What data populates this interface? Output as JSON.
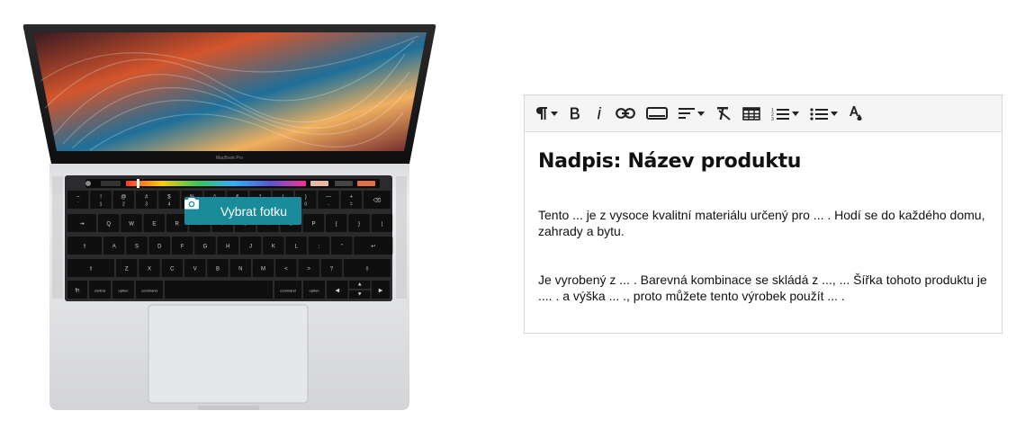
{
  "photo_button": {
    "label": "Vybrat fotku",
    "icon": "camera-icon"
  },
  "laptop": {
    "brand_label": "MacBook Pro",
    "keys": {
      "row1": [
        "~",
        "!",
        "@",
        "#",
        "$",
        "%",
        "^",
        "&",
        "*",
        "(",
        ")",
        "—",
        "+"
      ],
      "row1_sub": [
        "`",
        "1",
        "2",
        "3",
        "4",
        "5",
        "6",
        "7",
        "8",
        "9",
        "0",
        "-",
        "="
      ],
      "row2": [
        "Q",
        "W",
        "E",
        "R",
        "T",
        "Y",
        "U",
        "I",
        "O",
        "P",
        "{",
        "}",
        "|"
      ],
      "row3": [
        "A",
        "S",
        "D",
        "F",
        "G",
        "H",
        "J",
        "K",
        "L",
        ":",
        "\""
      ],
      "row4": [
        "Z",
        "X",
        "C",
        "V",
        "B",
        "N",
        "M",
        "<",
        ">",
        "?"
      ],
      "tab": "⇥",
      "caps": "⇪",
      "shift": "⇧",
      "delete": "⌫",
      "return": "↩",
      "fn": "fn",
      "control": "control",
      "option": "option",
      "command": "command"
    }
  },
  "editor": {
    "toolbar": [
      {
        "name": "paragraph-format-button",
        "icon": "pilcrow-icon",
        "dropdown": true
      },
      {
        "name": "bold-button",
        "icon": "bold-icon",
        "dropdown": false
      },
      {
        "name": "italic-button",
        "icon": "italic-icon",
        "dropdown": false
      },
      {
        "name": "link-button",
        "icon": "link-icon",
        "dropdown": false
      },
      {
        "name": "embed-button",
        "icon": "rectangle-icon",
        "dropdown": false
      },
      {
        "name": "align-button",
        "icon": "align-icon",
        "dropdown": true
      },
      {
        "name": "clear-format-button",
        "icon": "clear-format-icon",
        "dropdown": false
      },
      {
        "name": "table-button",
        "icon": "table-icon",
        "dropdown": false
      },
      {
        "name": "ordered-list-button",
        "icon": "ordered-list-icon",
        "dropdown": true
      },
      {
        "name": "unordered-list-button",
        "icon": "unordered-list-icon",
        "dropdown": true
      },
      {
        "name": "text-color-button",
        "icon": "text-color-icon",
        "dropdown": false
      }
    ],
    "heading": "Nadpis: Název produktu",
    "paragraph1": "Tento ... je z vysoce kvalitní materiálu určený pro ... . Hodí se do každého domu, zahrady a bytu.",
    "paragraph2": "Je vyrobený z ... . Barevná kombinace se skládá z ..., ... Šířka tohoto produktu je .... . a výška ... ., proto můžete tento výrobek použít ... ."
  },
  "colors": {
    "accent_button": "#1a8b9a",
    "toolbar_bg": "#f5f5f5",
    "border": "#d7d7d7"
  }
}
